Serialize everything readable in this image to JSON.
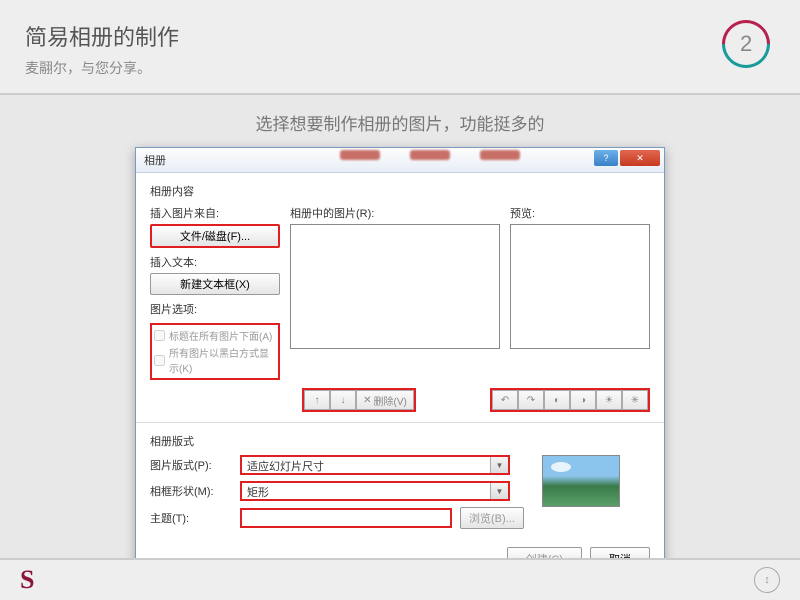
{
  "header": {
    "title": "简易相册的制作",
    "subtitle": "麦翮尔，与您分享。",
    "page_number": "2"
  },
  "instruction": "选择想要制作相册的图片，功能挺多的",
  "dialog": {
    "title": "相册",
    "section_content": "相册内容",
    "insert_from_label": "插入图片来自:",
    "file_disk_btn": "文件/磁盘(F)...",
    "insert_text_label": "插入文本:",
    "new_textbox_btn": "新建文本框(X)",
    "pic_options_label": "图片选项:",
    "caption_below": "标题在所有图片下面(A)",
    "black_white": "所有图片以黑白方式显示(K)",
    "list_label": "相册中的图片(R):",
    "preview_label": "预览:",
    "remove_btn": "删除(V)",
    "section_layout": "相册版式",
    "layout_label": "图片版式(P):",
    "layout_value": "适应幻灯片尺寸",
    "frame_label": "相框形状(M):",
    "frame_value": "矩形",
    "theme_label": "主题(T):",
    "theme_value": "",
    "browse_btn": "浏览(B)...",
    "create_btn": "创建(C)",
    "cancel_btn": "取消"
  },
  "footer": {
    "logo": "S",
    "scroll": "↕"
  }
}
